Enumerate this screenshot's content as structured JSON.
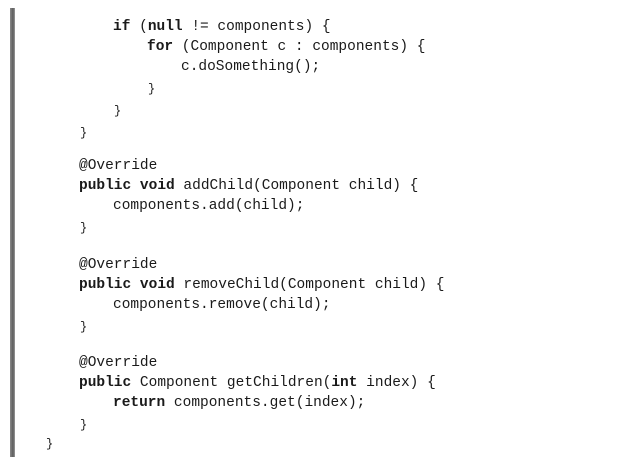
{
  "code": {
    "line1": {
      "kw1": "if",
      "t1": " (",
      "kw2": "null",
      "t2": " != components) {"
    },
    "line2": {
      "kw1": "for",
      "t1": " (Component c : components) {"
    },
    "line3": {
      "t1": "c.doSomething();"
    },
    "line4": {
      "t1": "}"
    },
    "line5": {
      "t1": "}"
    },
    "line6": {
      "t1": "}"
    },
    "line7": {
      "t1": "@Override"
    },
    "line8": {
      "kw1": "public",
      "t1": " ",
      "kw2": "void",
      "t2": " addChild(Component child) {"
    },
    "line9": {
      "t1": "components.add(child);"
    },
    "line10": {
      "t1": "}"
    },
    "line11": {
      "t1": "@Override"
    },
    "line12": {
      "kw1": "public",
      "t1": " ",
      "kw2": "void",
      "t2": " removeChild(Component child) {"
    },
    "line13": {
      "t1": "components.remove(child);"
    },
    "line14": {
      "t1": "}"
    },
    "line15": {
      "t1": "@Override"
    },
    "line16": {
      "kw1": "public",
      "t1": " Component getChildren(",
      "kw2": "int",
      "t2": " index) {"
    },
    "line17": {
      "kw1": "return",
      "t1": " components.get(index);"
    },
    "line18": {
      "t1": "}"
    },
    "line19": {
      "t1": "}"
    }
  }
}
